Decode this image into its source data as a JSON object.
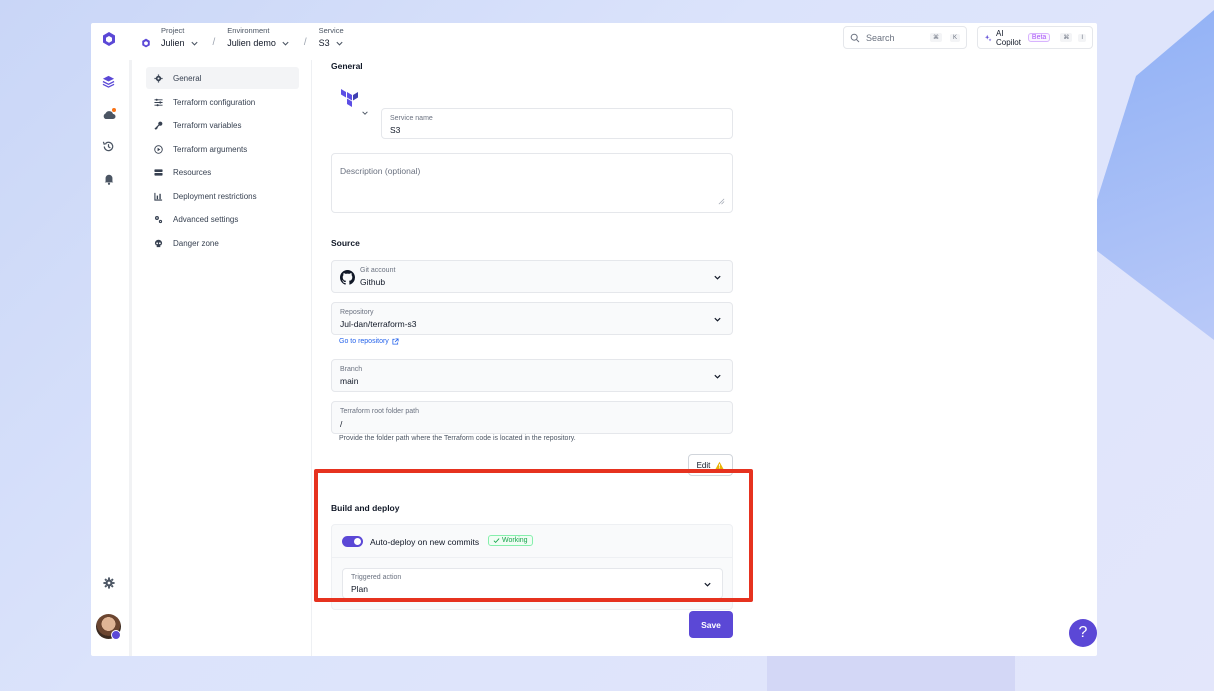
{
  "colors": {
    "accent": "#5b48d6",
    "highlight": "#e6321f",
    "working": "#16a34a",
    "link": "#2563eb"
  },
  "breadcrumb": [
    {
      "label": "Project",
      "value": "Julien"
    },
    {
      "label": "Environment",
      "value": "Julien demo"
    },
    {
      "label": "Service",
      "value": "S3"
    }
  ],
  "search": {
    "placeholder": "Search",
    "shortcut_1": "⌘",
    "shortcut_2": "K"
  },
  "copilot": {
    "label": "AI Copilot",
    "badge": "Beta",
    "shortcut_1": "⌘",
    "shortcut_2": "I"
  },
  "subnav": [
    {
      "label": "General",
      "icon": "gear-icon"
    },
    {
      "label": "Terraform configuration",
      "icon": "sliders-icon"
    },
    {
      "label": "Terraform variables",
      "icon": "key-icon"
    },
    {
      "label": "Terraform arguments",
      "icon": "play-circle-icon"
    },
    {
      "label": "Resources",
      "icon": "server-icon"
    },
    {
      "label": "Deployment restrictions",
      "icon": "chart-icon"
    },
    {
      "label": "Advanced settings",
      "icon": "cogs-icon"
    },
    {
      "label": "Danger zone",
      "icon": "skull-icon"
    }
  ],
  "general": {
    "title": "General",
    "service_name_label": "Service name",
    "service_name_value": "S3",
    "description_placeholder": "Description (optional)"
  },
  "source": {
    "title": "Source",
    "git_account_label": "Git account",
    "git_account_value": "Github",
    "repository_label": "Repository",
    "repository_value": "Jul-dan/terraform-s3",
    "go_to_repository": "Go to repository",
    "branch_label": "Branch",
    "branch_value": "main",
    "root_path_label": "Terraform root folder path",
    "root_path_value": "/",
    "root_path_hint": "Provide the folder path where the Terraform code is located in the repository.",
    "edit_label": "Edit"
  },
  "build": {
    "title": "Build and deploy",
    "auto_deploy_label": "Auto-deploy on new commits",
    "working_badge": "Working",
    "triggered_action_label": "Triggered action",
    "triggered_action_value": "Plan"
  },
  "save_label": "Save",
  "help_label": "?"
}
